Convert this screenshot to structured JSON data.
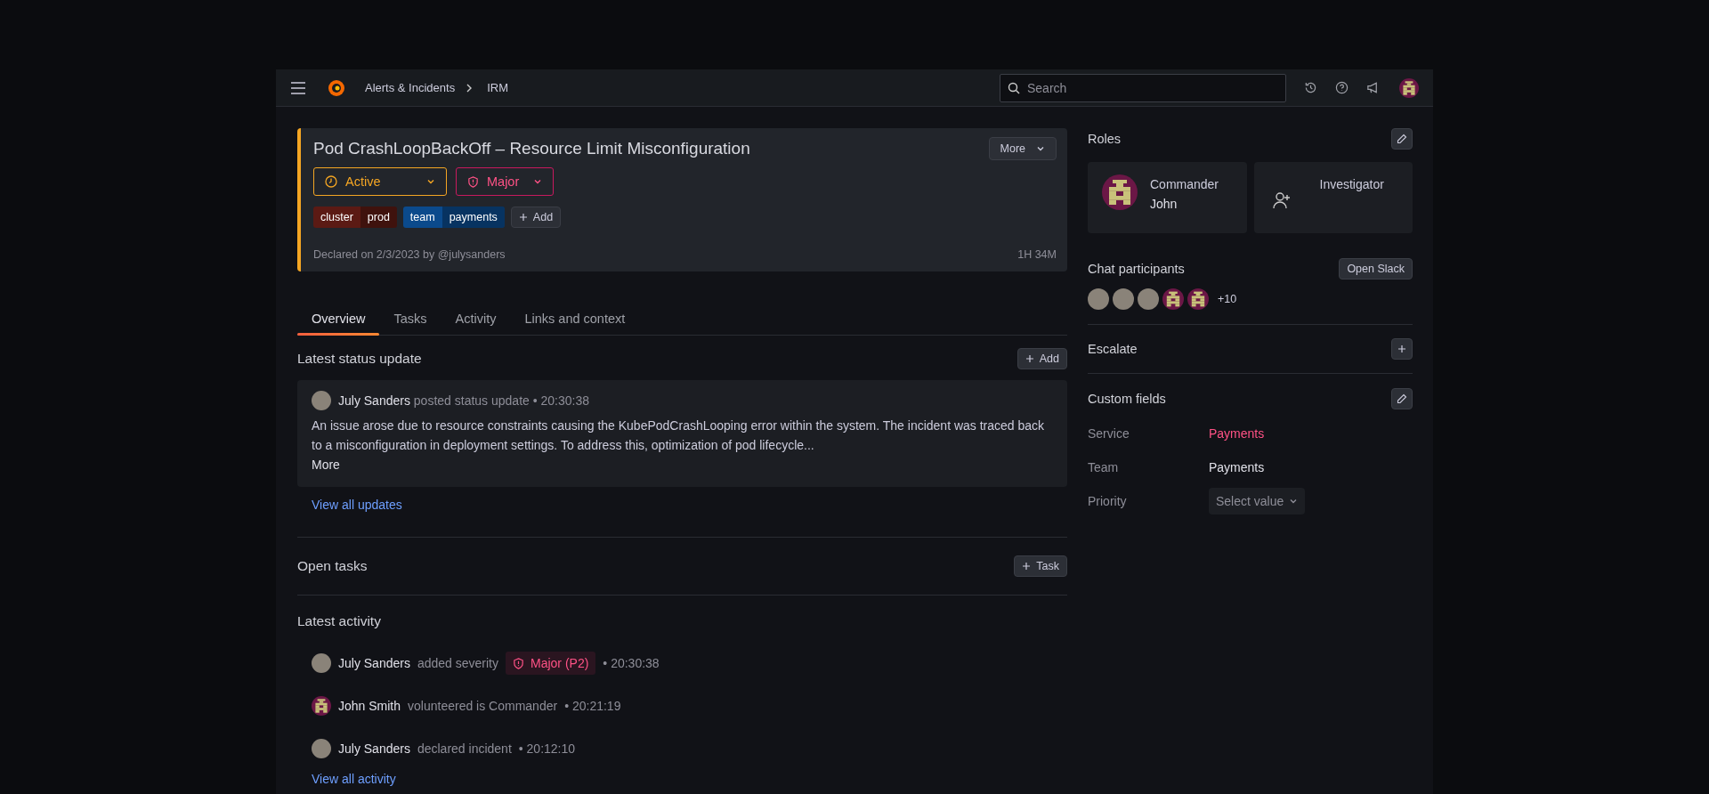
{
  "topbar": {
    "breadcrumbs": [
      "Alerts & Incidents",
      "IRM"
    ],
    "search": {
      "placeholder": "Search"
    }
  },
  "incident": {
    "title": "Pod CrashLoopBackOff – Resource Limit Misconfiguration",
    "more_button": "More",
    "status": {
      "label": "Active"
    },
    "severity": {
      "label": "Major"
    },
    "labels": [
      {
        "key": "cluster",
        "value": "prod",
        "color": "#5b1a14"
      },
      {
        "key": "team",
        "value": "payments",
        "color": "#0b4a8c"
      }
    ],
    "add_label": "Add",
    "declared": "Declared on 2/3/2023 by @julysanders",
    "duration": "1H 34M"
  },
  "tabs": [
    {
      "label": "Overview",
      "selected": true
    },
    {
      "label": "Tasks",
      "selected": false
    },
    {
      "label": "Activity",
      "selected": false
    },
    {
      "label": "Links and context",
      "selected": false
    }
  ],
  "status_update": {
    "heading": "Latest status update",
    "add_button": "Add",
    "author": "July Sanders",
    "action": "posted status update",
    "time": "• 20:30:38",
    "body": "An issue arose due to resource constraints causing the KubePodCrashLooping error within the system. The incident was traced back to a misconfiguration in deployment settings. To address this, optimization of pod lifecycle...",
    "more": "More",
    "view_all": "View all updates"
  },
  "open_tasks": {
    "heading": "Open tasks",
    "button": "Task"
  },
  "activity": {
    "heading": "Latest activity",
    "items": [
      {
        "kind": "photo",
        "author": "July Sanders",
        "action": "added severity",
        "badge": "Major (P2)",
        "time": "• 20:30:38"
      },
      {
        "kind": "identicon",
        "author": "John Smith",
        "action": "volunteered is Commander",
        "time": "• 20:21:19"
      },
      {
        "kind": "photo",
        "author": "July Sanders",
        "action": "declared incident",
        "time": "• 20:12:10"
      }
    ],
    "view_all": "View all activity"
  },
  "roles": {
    "heading": "Roles",
    "items": [
      {
        "kind": "assigned",
        "title": "Commander",
        "name": "John"
      },
      {
        "kind": "empty",
        "title": "Investigator"
      }
    ]
  },
  "chat": {
    "heading": "Chat participants",
    "button": "Open Slack",
    "participants": [
      {
        "kind": "photo"
      },
      {
        "kind": "photo"
      },
      {
        "kind": "photo"
      },
      {
        "kind": "identicon"
      },
      {
        "kind": "identicon"
      }
    ],
    "more": "+10"
  },
  "escalate": {
    "heading": "Escalate"
  },
  "custom_fields": {
    "heading": "Custom fields",
    "fields": [
      {
        "kind": "link",
        "label": "Service",
        "value": "Payments"
      },
      {
        "kind": "text",
        "label": "Team",
        "value": "Payments"
      },
      {
        "kind": "select",
        "label": "Priority",
        "value": "Select value"
      }
    ]
  }
}
